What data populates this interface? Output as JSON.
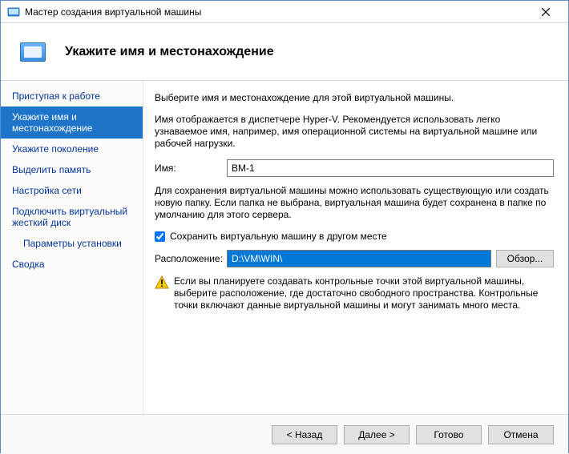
{
  "window": {
    "title": "Мастер создания виртуальной машины"
  },
  "header": {
    "title": "Укажите имя и местонахождение"
  },
  "sidebar": {
    "items": [
      {
        "label": "Приступая к работе",
        "selected": false
      },
      {
        "label": "Укажите имя и местонахождение",
        "selected": true
      },
      {
        "label": "Укажите поколение",
        "selected": false
      },
      {
        "label": "Выделить память",
        "selected": false
      },
      {
        "label": "Настройка сети",
        "selected": false
      },
      {
        "label": "Подключить виртуальный жесткий диск",
        "selected": false
      },
      {
        "label": "Параметры установки",
        "selected": false,
        "indent": true
      },
      {
        "label": "Сводка",
        "selected": false
      }
    ]
  },
  "content": {
    "intro": "Выберите имя и местонахождение для этой виртуальной машины.",
    "name_help": "Имя отображается в диспетчере Hyper-V. Рекомендуется использовать легко узнаваемое имя, например, имя операционной системы на виртуальной машине или рабочей нагрузки.",
    "name_label": "Имя:",
    "name_value": "ВМ-1",
    "folder_help": "Для сохранения виртуальной машины можно использовать существующую или создать новую папку. Если папка не выбрана, виртуальная машина будет сохранена в папке по умолчанию для этого сервера.",
    "store_checkbox_label": "Сохранить виртуальную машину в другом месте",
    "store_checkbox_checked": true,
    "location_label": "Расположение:",
    "location_value": "D:\\VM\\WIN\\",
    "browse_label": "Обзор...",
    "warning_text": "Если вы планируете создавать контрольные точки этой виртуальной машины, выберите расположение, где достаточно свободного пространства. Контрольные точки включают данные виртуальной машины и могут занимать много места."
  },
  "footer": {
    "back": "< Назад",
    "next": "Далее >",
    "finish": "Готово",
    "cancel": "Отмена"
  }
}
